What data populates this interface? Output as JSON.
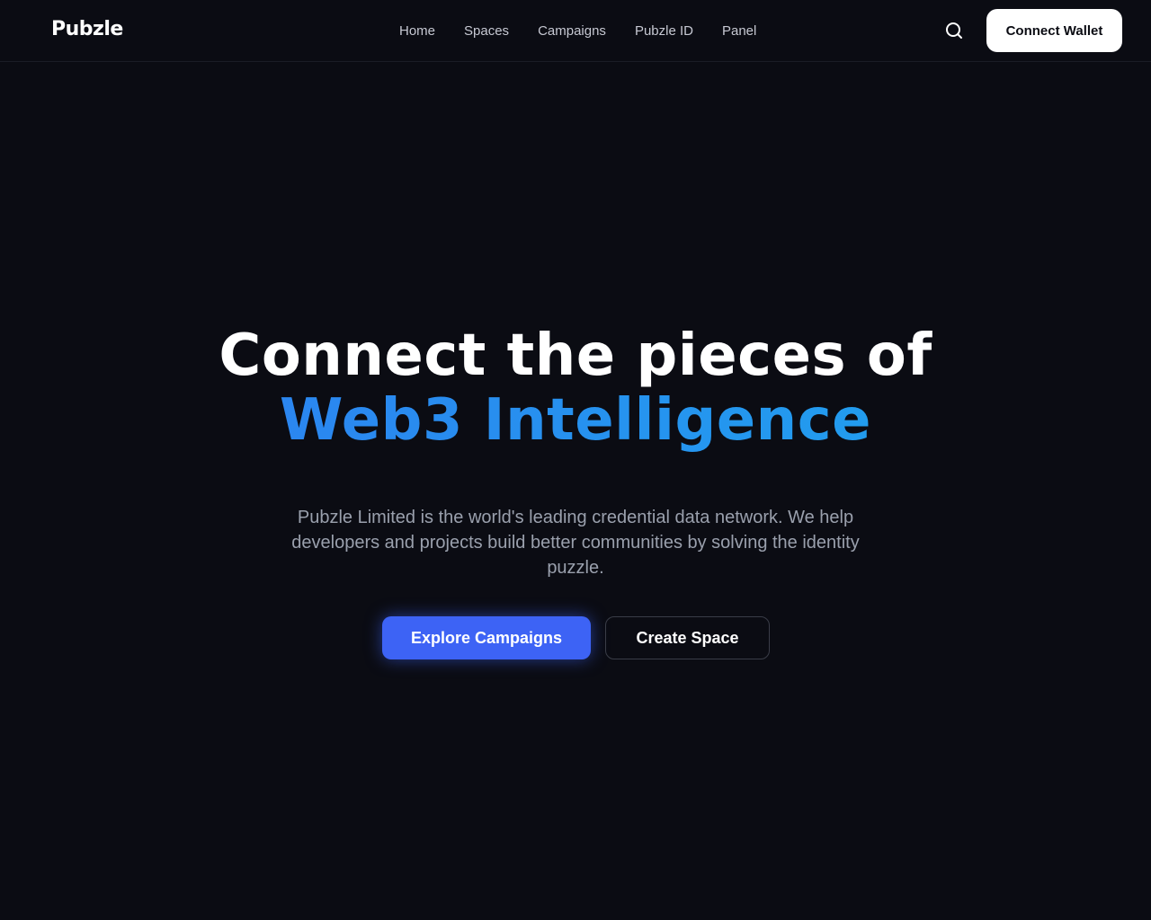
{
  "header": {
    "logo": "Pubzle",
    "nav": [
      {
        "label": "Home"
      },
      {
        "label": "Spaces"
      },
      {
        "label": "Campaigns"
      },
      {
        "label": "Pubzle ID"
      },
      {
        "label": "Panel"
      }
    ],
    "search_icon": "search-icon",
    "connect_wallet_label": "Connect Wallet"
  },
  "hero": {
    "title_line1": "Connect the pieces of",
    "title_line2": "Web3 Intelligence",
    "subtitle": "Pubzle Limited is the world's leading credential data network. We help developers and projects build better communities by solving the identity puzzle.",
    "primary_cta": "Explore Campaigns",
    "secondary_cta": "Create Space"
  },
  "colors": {
    "background": "#0b0c13",
    "accent": "#3d63f5",
    "gradient_start": "#2f7cf0",
    "gradient_end": "#1ea6ee"
  }
}
